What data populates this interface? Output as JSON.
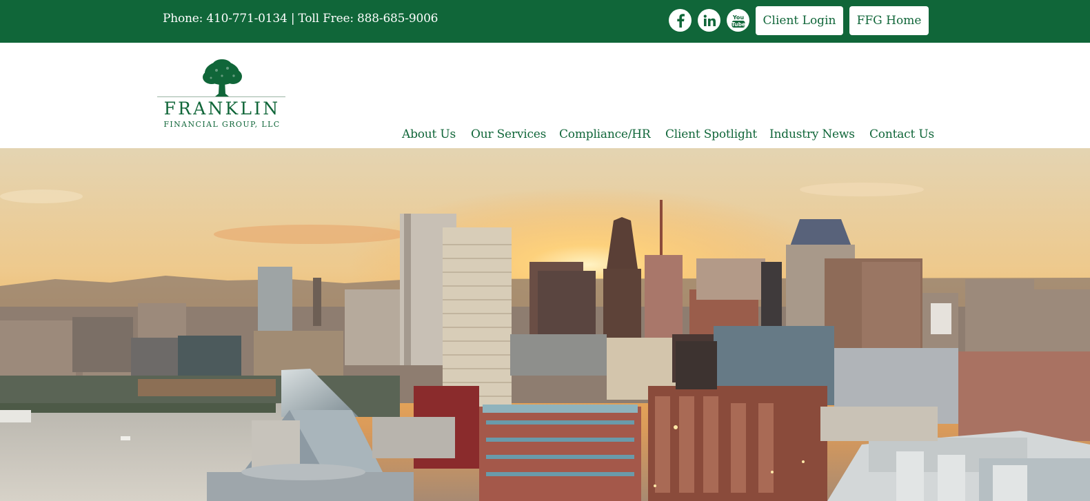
{
  "topbar": {
    "phone_text": "Phone: 410-771-0134 | Toll Free: 888-685-9006",
    "social": [
      "facebook-icon",
      "linkedin-icon",
      "youtube-icon"
    ],
    "client_login_label": "Client Login",
    "ffg_home_label": "FFG Home"
  },
  "logo": {
    "name": "FRANKLIN",
    "subtitle": "FINANCIAL GROUP, LLC"
  },
  "nav": {
    "items": [
      "About Us",
      "Our Services",
      "Compliance/HR",
      "Client Spotlight",
      "Industry News",
      "Contact Us"
    ]
  },
  "hero": {
    "image": "city-skyline-sunset-photo"
  },
  "colors": {
    "brand_green": "#106639",
    "white": "#ffffff"
  }
}
